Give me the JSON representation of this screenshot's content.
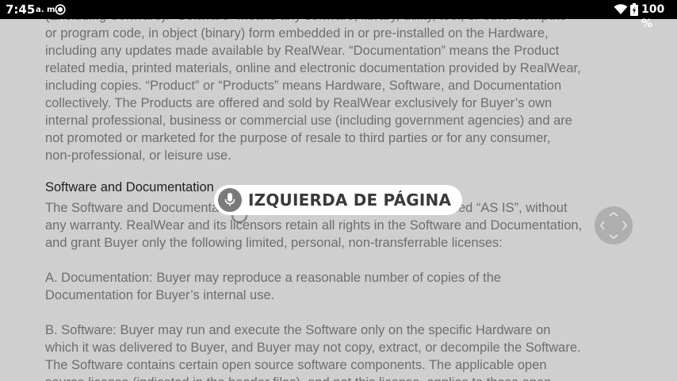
{
  "status_bar": {
    "time": "7:45",
    "ampm": "a. m.",
    "battery_text": "100 %",
    "icons": [
      "screen-record-icon",
      "wifi-icon",
      "battery-icon"
    ]
  },
  "voice_command": {
    "text": "IZQUIERDA DE PÁGINA",
    "icon": "microphone-icon"
  },
  "document": {
    "para1": [
      "(Excluding Software). “Software” means any software, library, utility, tool, or other compute",
      "or program code, in object (binary) form embedded in or pre-installed on the Hardware,",
      "including any updates made available by RealWear. “Documentation” means the Product",
      "related media, printed materials, online and electronic documentation provided by RealWear,",
      "including copies. “Product” or “Products” means Hardware, Software, and Documentation",
      "collectively. The Products are offered and sold by RealWear exclusively for Buyer’s own",
      "internal professional, business or commercial use (including government agencies) and are",
      "not promoted or marketed for the purpose of resale to third parties or for any consumer,",
      "non-professional, or leisure use."
    ],
    "heading": "Software and Documentation",
    "para2": [
      "The Software and Documentation are licensed, not sold, and are provided “AS IS”, without",
      "any warranty. RealWear and its licensors retain all rights in the Software and Documentation,",
      "and grant Buyer only the following limited, personal, non-transferrable licenses:"
    ],
    "para3": [
      "A. Documentation: Buyer may reproduce a reasonable number of copies of the",
      "Documentation for Buyer’s internal use."
    ],
    "para4": [
      "B. Software: Buyer may run and execute the Software only on the specific Hardware on",
      "which it was delivered to Buyer, and Buyer may not copy, extract, or decompile the Software.",
      "The Software contains certain open source software components. The applicable open",
      "source license (indicated in the header files), and not this license, applies to those open"
    ]
  },
  "colors": {
    "background": "#cfcfcf",
    "body_text": "#6e6e6e",
    "heading_text": "#1f1f1f",
    "status_bar": "#000000"
  }
}
